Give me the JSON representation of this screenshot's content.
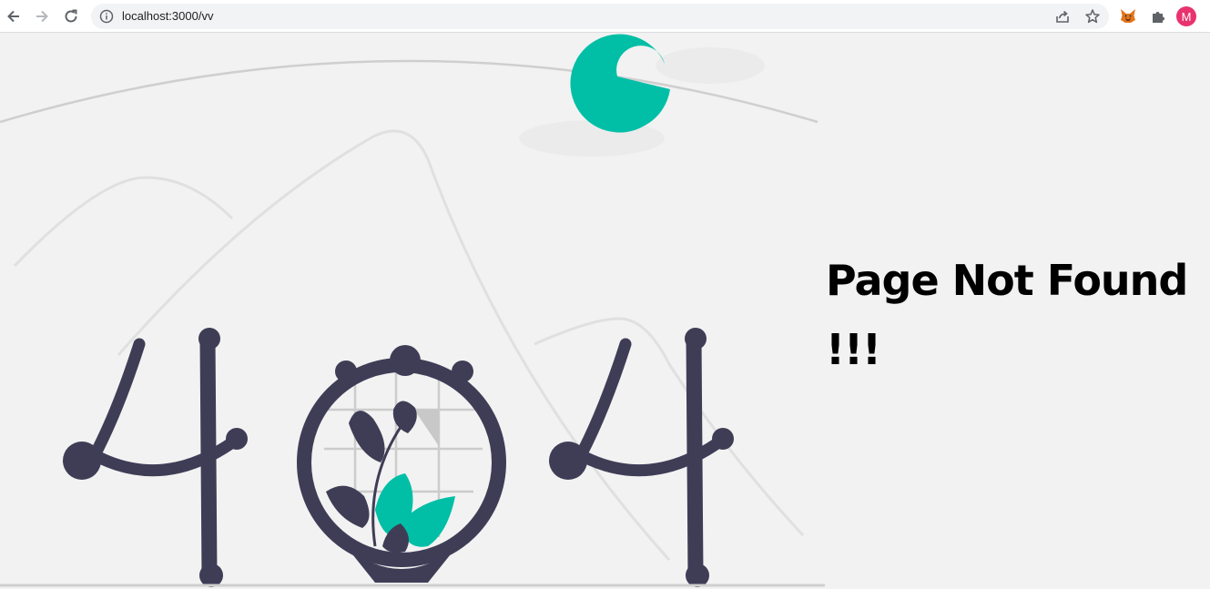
{
  "browser": {
    "url": "localhost:3000/vv",
    "profile_initial": "M",
    "icons": {
      "back": "arrow-left-icon",
      "forward": "arrow-right-icon",
      "reload": "reload-icon",
      "info": "info-icon",
      "share": "share-icon",
      "bookmark": "star-icon",
      "metamask": "fox-icon",
      "extensions": "puzzle-icon"
    },
    "profile_color": "#e8336f"
  },
  "page": {
    "heading": "Page Not Found",
    "exclaim": "!!!",
    "colors": {
      "accent": "#00bfa6",
      "dark": "#3f3d56",
      "background": "#f2f2f2"
    }
  }
}
